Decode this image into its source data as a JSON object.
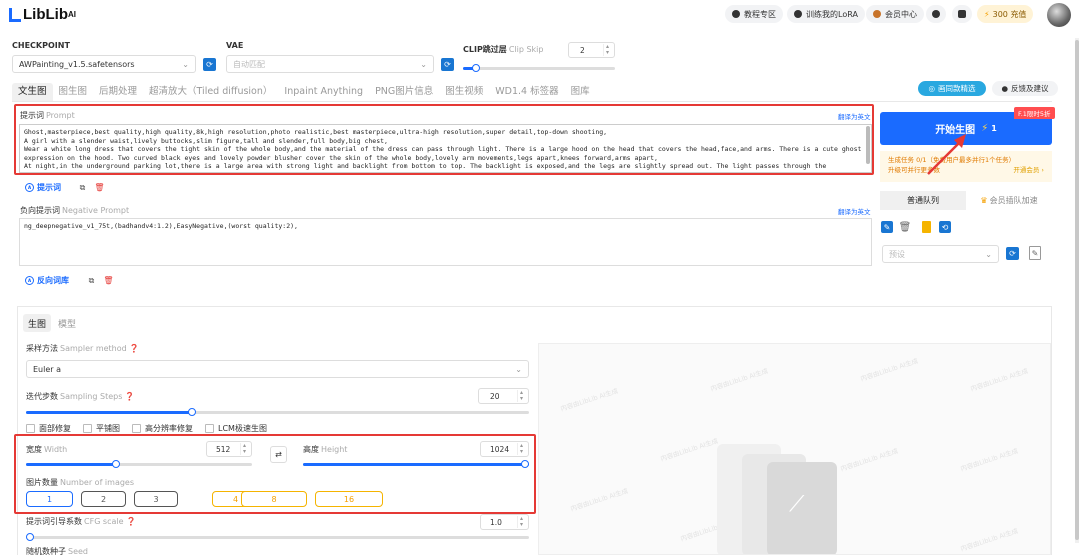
{
  "header": {
    "logo": "LibLib",
    "logo_sup": "AI",
    "tutorial": "教程专区",
    "train_lora": "训练我的LoRA",
    "member_center": "会员中心",
    "recharge": "300 充值"
  },
  "model": {
    "checkpoint_label": "CHECKPOINT",
    "checkpoint_value": "AWPainting_v1.5.safetensors",
    "vae_label": "VAE",
    "vae_value": "自动匹配",
    "clip_label": "CLIP跳过层",
    "clip_sub": "Clip Skip",
    "clip_value": "2",
    "clip_fraction": 0.083
  },
  "tabs": [
    "文生图",
    "图生图",
    "后期处理",
    "超清放大（Tiled diffusion）",
    "Inpaint Anything",
    "PNG图片信息",
    "图生视频",
    "WD1.4 标签器",
    "图库"
  ],
  "prompt": {
    "label": "提示词",
    "label_en": "Prompt",
    "translate": "翻译为英文",
    "text": "Ghost,masterpiece,best quality,high quality,8k,high resolution,photo realistic,best masterpiece,ultra-high resolution,super detail,top-down shooting,\nA girl with a slender waist,lively buttocks,slim figure,tall and slender,full body,big chest,\nWear a white long dress that covers the tight skin of the whole body,and the material of the dress can pass through light. There is a large hood on the head that covers the head,face,and arms. There is a cute ghost expression on the hood. Two curved black eyes and lovely powder blusher cover the skin of the whole body,lovely arm movements,legs apart,knees forward,arms apart,\nAt night,in the underground parking lot,there is a large area with strong light and backlight from bottom to top. The backlight is exposed,and the legs are slightly spread out. The light passes through the",
    "library_btn": "提示词"
  },
  "negative": {
    "label": "负向提示词",
    "label_en": "Negative Prompt",
    "translate": "翻译为英文",
    "text": "ng_deepnegative_v1_75t,(badhandv4:1.2),EasyNegative,(worst quality:2),",
    "library_btn": "反向词库"
  },
  "subtabs": [
    "生图",
    "模型"
  ],
  "sampler": {
    "label": "采样方法",
    "label_en": "Sampler method",
    "value": "Euler a"
  },
  "steps": {
    "label": "迭代步数",
    "label_en": "Sampling Steps",
    "value": "20",
    "fraction": 0.33
  },
  "options": [
    "面部修复",
    "平铺图",
    "高分辨率修复",
    "LCM极速生图"
  ],
  "size": {
    "width_label": "宽度",
    "width_en": "Width",
    "width_value": "512",
    "width_fraction": 0.4,
    "height_label": "高度",
    "height_en": "Height",
    "height_value": "1024",
    "height_fraction": 1.0
  },
  "batch": {
    "label": "图片数量",
    "label_en": "Number of images",
    "options": [
      "1",
      "2",
      "3",
      "4",
      "8",
      "16"
    ]
  },
  "cfg": {
    "label": "提示词引导系数",
    "label_en": "CFG scale",
    "value": "1.0",
    "fraction": 0.0
  },
  "seed": {
    "label": "随机数种子",
    "label_en": "Seed"
  },
  "right": {
    "featured_btn": "画同款精选",
    "feedback_btn": "反馈及建议",
    "generate": "开始生图",
    "generate_cost": "1",
    "limited_tag": "F.1限时5折",
    "info_line1": "生成任务 0/1（免费用户最多并行1个任务）",
    "info_line2": "升级可并行更多数",
    "info_link": "开通会员 ›",
    "queue_normal": "普通队列",
    "queue_vip": "会员插队加速",
    "preset_placeholder": "预设"
  },
  "watermark": "内容由LibLib AI生成",
  "colors": {
    "accent": "#1a6bff",
    "highlight_border": "#e53935",
    "gold": "#f5a000"
  }
}
